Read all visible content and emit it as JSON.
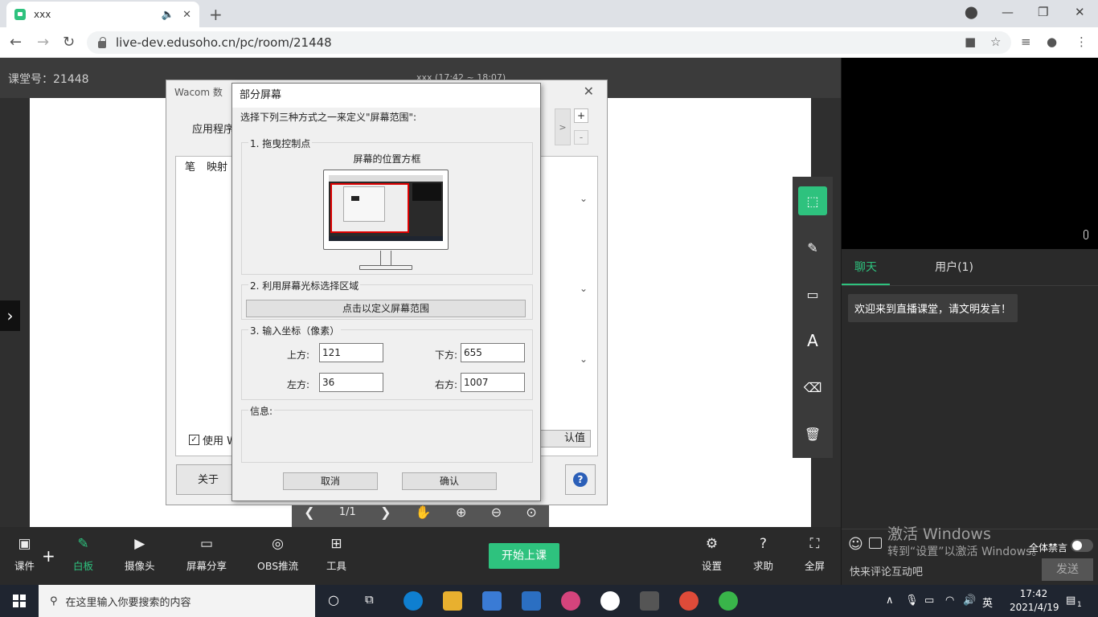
{
  "browser": {
    "tab_title": "xxx",
    "url": "live-dev.edusoho.cn/pc/room/21448"
  },
  "room": {
    "room_label": "课堂号：21448",
    "course_title": "xxx",
    "course_time": "(17:42 ~ 18:07)"
  },
  "pager": {
    "page": "1/1"
  },
  "chat": {
    "tab_chat": "聊天",
    "tab_users": "用户(1)",
    "welcome": "欢迎来到直播课堂，请文明发言！",
    "mute_all": "全体禁言",
    "placeholder": "快来评论互动吧",
    "send": "发送"
  },
  "activation": {
    "line1": "激活 Windows",
    "line2": "转到“设置”以激活 Windows。"
  },
  "toolbar": {
    "courseware": "课件",
    "whiteboard": "白板",
    "camera": "摄像头",
    "screen_share": "屏幕分享",
    "obs": "OBS推流",
    "tools": "工具",
    "start": "开始上课",
    "settings": "设置",
    "help": "求助",
    "fullscreen": "全屏"
  },
  "taskbar": {
    "search_placeholder": "在这里输入你要搜索的内容",
    "ime": "英",
    "time": "17:42",
    "date": "2021/4/19",
    "notifications": "1"
  },
  "wacom": {
    "title": "Wacom 数",
    "app_label": "应用程序",
    "tab_pen": "笔",
    "tab_mapping": "映射",
    "use_label": "使用 W",
    "about": "关于",
    "default_btn": "认值"
  },
  "dialog": {
    "title": "部分屏幕",
    "instruction": "选择下列三种方式之一来定义\"屏幕范围\":",
    "group1_label": "1. 拖曳控制点",
    "monitor_caption": "屏幕的位置方框",
    "group2_label": "2. 利用屏幕光标选择区域",
    "define_btn": "点击以定义屏幕范围",
    "group3_label": "3. 输入坐标（像素）",
    "top_label": "上方:",
    "top_value": "121",
    "bottom_label": "下方:",
    "bottom_value": "655",
    "left_label": "左方:",
    "left_value": "36",
    "right_label": "右方:",
    "right_value": "1007",
    "info_label": "信息:",
    "cancel": "取消",
    "confirm": "确认"
  },
  "colors": {
    "accent": "#2ec27e",
    "dialog_bg": "#f0f0f0",
    "page_bg": "#1b1b1b"
  }
}
